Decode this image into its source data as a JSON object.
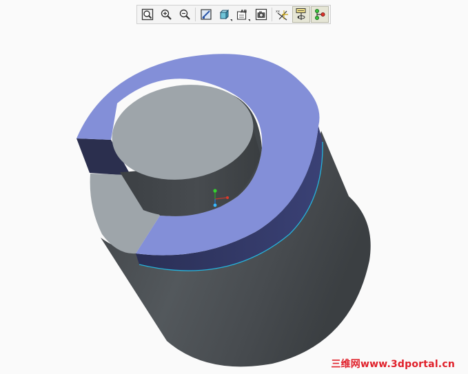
{
  "toolbar": {
    "buttons": [
      {
        "icon": "zoom-fit-icon",
        "name": "refit-button"
      },
      {
        "icon": "zoom-in-icon",
        "name": "zoom-in-button"
      },
      {
        "icon": "zoom-out-icon",
        "name": "zoom-out-button"
      },
      {
        "icon": "repaint-icon",
        "name": "repaint-button"
      },
      {
        "icon": "display-style-icon",
        "name": "display-style-button"
      },
      {
        "icon": "saved-views-icon",
        "name": "saved-views-button"
      },
      {
        "icon": "snapshot-icon",
        "name": "snapshot-button"
      },
      {
        "icon": "datum-display-icon",
        "name": "datum-display-button"
      },
      {
        "icon": "spin-center-icon",
        "name": "spin-center-button",
        "active": true
      },
      {
        "icon": "annotation-display-icon",
        "name": "annotation-display-button",
        "active": true
      }
    ]
  },
  "colors": {
    "background": "#fafafa",
    "cylinder_body": "#474c50",
    "selected_face": "#838fd8",
    "selected_edge": "#25b4dc",
    "inner_face": "#9ea5aa",
    "watermark": "#e0202a"
  },
  "watermark": {
    "text": "三维网www.3dportal.cn"
  }
}
